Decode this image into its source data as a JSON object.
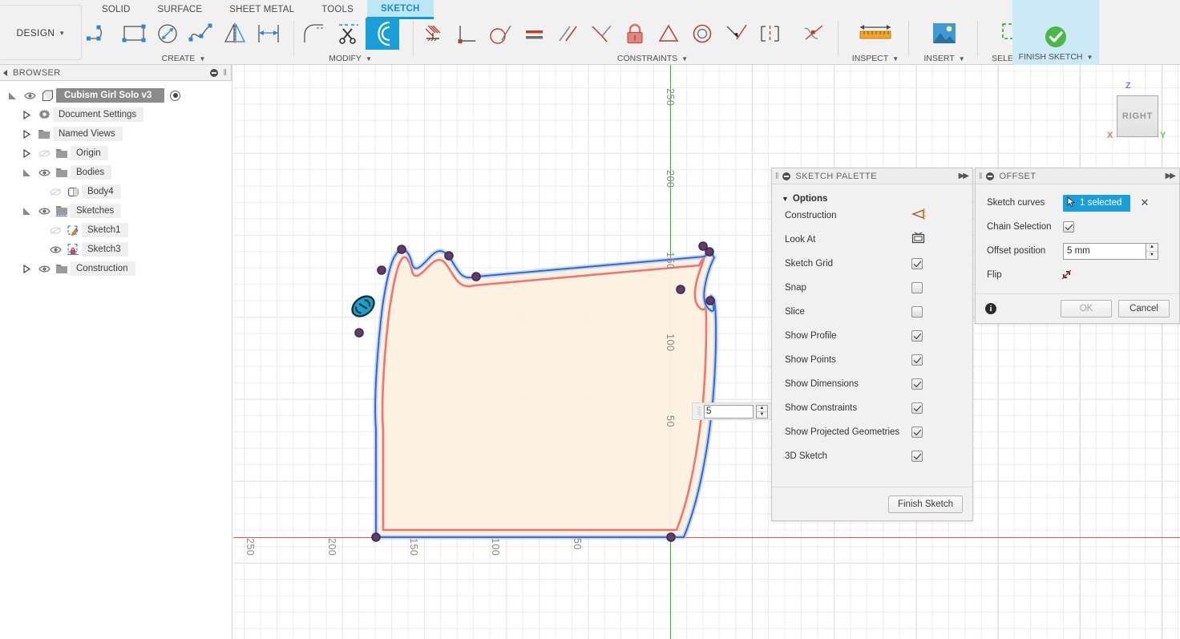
{
  "app": {
    "workspace_label": "DESIGN",
    "tabs": [
      {
        "label": "SOLID",
        "active": false
      },
      {
        "label": "SURFACE",
        "active": false
      },
      {
        "label": "SHEET METAL",
        "active": false
      },
      {
        "label": "TOOLS",
        "active": false
      },
      {
        "label": "SKETCH",
        "active": true
      }
    ]
  },
  "toolbar": {
    "groups": [
      {
        "label": "CREATE",
        "commands": [
          {
            "name": "line-icon",
            "tooltip": "Line"
          },
          {
            "name": "rectangle-icon",
            "tooltip": "Rectangle"
          },
          {
            "name": "circle-icon",
            "tooltip": "Circle"
          },
          {
            "name": "spline-icon",
            "tooltip": "Spline"
          },
          {
            "name": "mirror-icon",
            "tooltip": "Mirror"
          },
          {
            "name": "dimension-icon",
            "tooltip": "Sketch Dimension"
          }
        ]
      },
      {
        "label": "MODIFY",
        "commands": [
          {
            "name": "fillet-icon",
            "tooltip": "Fillet"
          },
          {
            "name": "trim-scissors-icon",
            "tooltip": "Trim"
          },
          {
            "name": "offset-icon",
            "tooltip": "Offset",
            "selected": true
          }
        ]
      },
      {
        "label": "CONSTRAINTS",
        "commands": [
          {
            "name": "fix-ground-icon",
            "tooltip": "Fix/Unfix"
          },
          {
            "name": "perpendicular-icon",
            "tooltip": "Perpendicular"
          },
          {
            "name": "tangent-icon",
            "tooltip": "Tangent"
          },
          {
            "name": "equal-icon",
            "tooltip": "Equal"
          },
          {
            "name": "parallel-icon",
            "tooltip": "Parallel"
          },
          {
            "name": "midpoint-icon",
            "tooltip": "Midpoint"
          },
          {
            "name": "fix-lock-icon",
            "tooltip": "Fix"
          },
          {
            "name": "symmetry-icon",
            "tooltip": "Symmetry"
          },
          {
            "name": "concentric-icon",
            "tooltip": "Concentric"
          },
          {
            "name": "collinear-icon",
            "tooltip": "Collinear"
          },
          {
            "name": "curvature-icon",
            "tooltip": "Curvature"
          },
          {
            "name": "coincident-icon",
            "tooltip": "Coincident"
          }
        ]
      },
      {
        "label": "INSPECT",
        "commands": [
          {
            "name": "measure-ruler-icon",
            "tooltip": "Measure"
          }
        ]
      },
      {
        "label": "INSERT",
        "commands": [
          {
            "name": "insert-image-icon",
            "tooltip": "Insert Image"
          }
        ]
      },
      {
        "label": "SELECT",
        "commands": [
          {
            "name": "select-window-icon",
            "tooltip": "Select"
          }
        ]
      },
      {
        "label": "FINISH SKETCH",
        "commands": [
          {
            "name": "finish-sketch-check-icon",
            "tooltip": "Finish Sketch"
          }
        ]
      }
    ]
  },
  "browser": {
    "title": "BROWSER",
    "nodes": [
      {
        "label": "Cubism Girl Solo v3",
        "indent": 0,
        "expander": "down",
        "eye": "visible",
        "icon": "component-icon",
        "root": true,
        "radio": true
      },
      {
        "label": "Document Settings",
        "indent": 1,
        "expander": "right",
        "eye": "none",
        "icon": "gear-icon"
      },
      {
        "label": "Named Views",
        "indent": 1,
        "expander": "right",
        "eye": "none",
        "icon": "folder-icon"
      },
      {
        "label": "Origin",
        "indent": 1,
        "expander": "right",
        "eye": "hidden",
        "icon": "folder-icon",
        "dim": true
      },
      {
        "label": "Bodies",
        "indent": 1,
        "expander": "down",
        "eye": "visible",
        "icon": "folder-icon"
      },
      {
        "label": "Body4",
        "indent": 2,
        "expander": "none",
        "eye": "hidden",
        "icon": "body-icon",
        "dim": true
      },
      {
        "label": "Sketches",
        "indent": 1,
        "expander": "down",
        "eye": "visible",
        "icon": "folder-sketch-icon"
      },
      {
        "label": "Sketch1",
        "indent": 2,
        "expander": "none",
        "eye": "hidden",
        "icon": "sketch-pencil-icon",
        "dim": true
      },
      {
        "label": "Sketch3",
        "indent": 2,
        "expander": "none",
        "eye": "visible",
        "icon": "sketch-lock-icon"
      },
      {
        "label": "Construction",
        "indent": 1,
        "expander": "right",
        "eye": "visible",
        "icon": "folder-icon"
      }
    ]
  },
  "canvas": {
    "value_input": {
      "value": "5",
      "name": "offset-distance-input"
    },
    "viewcube": {
      "face_label": "RIGHT",
      "axes": [
        {
          "label": "Z",
          "color": "#7a7ae6"
        },
        {
          "label": "Y",
          "color": "#57c957"
        },
        {
          "label": "X",
          "color": "#f07070"
        }
      ]
    },
    "horizontal_ruler_labels": [
      "250",
      "200",
      "150",
      "100",
      "50"
    ],
    "vertical_ruler_labels": [
      "250",
      "200",
      "150",
      "100",
      "50"
    ],
    "colors": {
      "profile_fill": "#fdf0e0",
      "original_curve": "#2e5fd8",
      "offset_preview": "#f4736e",
      "x_axis": "#e8564d",
      "y_axis": "#2db82d",
      "point": "#7a3b6e",
      "constraint_glyph": "#1aa0c8"
    }
  },
  "sketch_palette": {
    "title": "SKETCH PALETTE",
    "section": "Options",
    "rows": [
      {
        "label": "Construction",
        "control": "icon",
        "icon": "construction-icon"
      },
      {
        "label": "Look At",
        "control": "icon",
        "icon": "look-at-icon"
      },
      {
        "label": "Sketch Grid",
        "control": "checkbox",
        "checked": true
      },
      {
        "label": "Snap",
        "control": "checkbox",
        "checked": false
      },
      {
        "label": "Slice",
        "control": "checkbox",
        "checked": false
      },
      {
        "label": "Show Profile",
        "control": "checkbox",
        "checked": true
      },
      {
        "label": "Show Points",
        "control": "checkbox",
        "checked": true
      },
      {
        "label": "Show Dimensions",
        "control": "checkbox",
        "checked": true
      },
      {
        "label": "Show Constraints",
        "control": "checkbox",
        "checked": true
      },
      {
        "label": "Show Projected Geometries",
        "control": "checkbox",
        "checked": true
      },
      {
        "label": "3D Sketch",
        "control": "checkbox",
        "checked": true
      }
    ],
    "finish_button": "Finish Sketch"
  },
  "offset_dialog": {
    "title": "OFFSET",
    "rows": {
      "sketch_curves_label": "Sketch curves",
      "sketch_curves_value": "1 selected",
      "chain_selection_label": "Chain Selection",
      "chain_selection_checked": true,
      "offset_position_label": "Offset position",
      "offset_position_value": "5 mm",
      "flip_label": "Flip"
    },
    "ok_label": "OK",
    "cancel_label": "Cancel"
  }
}
